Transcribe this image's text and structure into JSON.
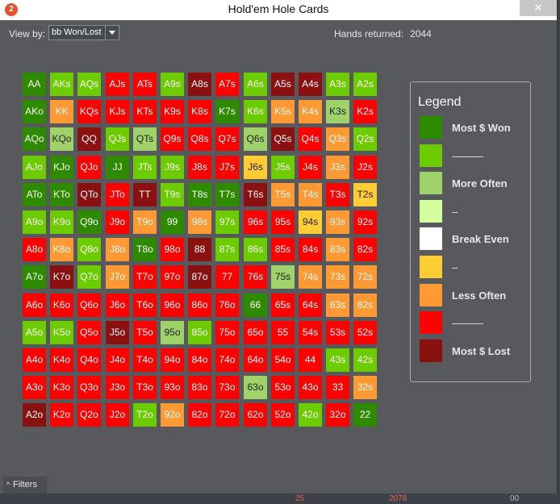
{
  "window": {
    "title": "Hold'em Hole Cards",
    "app_icon": "2",
    "close_glyph": "✕"
  },
  "toolbar": {
    "view_by_label": "View by:",
    "view_by_value": "bb Won/Lost",
    "hands_label": "Hands returned:",
    "hands_value": "2044"
  },
  "grid": {
    "rows": [
      [
        "AA",
        "AKs",
        "AQs",
        "AJs",
        "ATs",
        "A9s",
        "A8s",
        "A7s",
        "A6s",
        "A5s",
        "A4s",
        "A3s",
        "A2s"
      ],
      [
        "AKo",
        "KK",
        "KQs",
        "KJs",
        "KTs",
        "K9s",
        "K8s",
        "K7s",
        "K6s",
        "K5s",
        "K4s",
        "K3s",
        "K2s"
      ],
      [
        "AQo",
        "KQo",
        "QQ",
        "QJs",
        "QTs",
        "Q9s",
        "Q8s",
        "Q7s",
        "Q6s",
        "Q5s",
        "Q4s",
        "Q3s",
        "Q2s"
      ],
      [
        "AJo",
        "KJo",
        "QJo",
        "JJ",
        "JTs",
        "J9s",
        "J8s",
        "J7s",
        "J6s",
        "J5s",
        "J4s",
        "J3s",
        "J2s"
      ],
      [
        "ATo",
        "KTo",
        "QTo",
        "JTo",
        "TT",
        "T9s",
        "T8s",
        "T7s",
        "T6s",
        "T5s",
        "T4s",
        "T3s",
        "T2s"
      ],
      [
        "A9o",
        "K9o",
        "Q9o",
        "J9o",
        "T9o",
        "99",
        "98s",
        "97s",
        "96s",
        "95s",
        "94s",
        "93s",
        "92s"
      ],
      [
        "A8o",
        "K8o",
        "Q8o",
        "J8o",
        "T8o",
        "98o",
        "88",
        "87s",
        "86s",
        "85s",
        "84s",
        "83s",
        "82s"
      ],
      [
        "A7o",
        "K7o",
        "Q7o",
        "J7o",
        "T7o",
        "97o",
        "87o",
        "77",
        "76s",
        "75s",
        "74s",
        "73s",
        "72s"
      ],
      [
        "A6o",
        "K6o",
        "Q6o",
        "J6o",
        "T6o",
        "96o",
        "86o",
        "76o",
        "66",
        "65s",
        "64s",
        "63s",
        "62s"
      ],
      [
        "A5o",
        "K5o",
        "Q5o",
        "J5o",
        "T5o",
        "95o",
        "85o",
        "75o",
        "65o",
        "55",
        "54s",
        "53s",
        "52s"
      ],
      [
        "A4o",
        "K4o",
        "Q4o",
        "J4o",
        "T4o",
        "94o",
        "84o",
        "74o",
        "64o",
        "54o",
        "44",
        "43s",
        "42s"
      ],
      [
        "A3o",
        "K3o",
        "Q3o",
        "J3o",
        "T3o",
        "93o",
        "83o",
        "73o",
        "63o",
        "53o",
        "43o",
        "33",
        "32s"
      ],
      [
        "A2o",
        "K2o",
        "Q2o",
        "J2o",
        "T2o",
        "92o",
        "82o",
        "72o",
        "62o",
        "52o",
        "42o",
        "32o",
        "22"
      ]
    ],
    "levels": [
      [
        0,
        1,
        1,
        7,
        7,
        1,
        8,
        7,
        1,
        8,
        8,
        1,
        1
      ],
      [
        0,
        6,
        7,
        7,
        7,
        7,
        7,
        0,
        1,
        6,
        6,
        2,
        7
      ],
      [
        0,
        2,
        8,
        1,
        2,
        7,
        7,
        7,
        2,
        8,
        7,
        6,
        1
      ],
      [
        1,
        0,
        7,
        0,
        1,
        1,
        7,
        7,
        5,
        1,
        7,
        6,
        7
      ],
      [
        0,
        0,
        8,
        7,
        8,
        1,
        0,
        0,
        8,
        6,
        6,
        7,
        5
      ],
      [
        1,
        1,
        0,
        7,
        6,
        0,
        6,
        1,
        7,
        7,
        5,
        6,
        7
      ],
      [
        7,
        6,
        1,
        6,
        0,
        7,
        8,
        1,
        1,
        7,
        7,
        6,
        7
      ],
      [
        0,
        8,
        1,
        6,
        7,
        7,
        8,
        7,
        7,
        2,
        6,
        6,
        6
      ],
      [
        7,
        7,
        7,
        7,
        7,
        7,
        7,
        7,
        0,
        7,
        7,
        6,
        6
      ],
      [
        1,
        1,
        7,
        8,
        7,
        2,
        1,
        7,
        7,
        7,
        7,
        7,
        7
      ],
      [
        7,
        7,
        7,
        7,
        7,
        7,
        7,
        7,
        7,
        7,
        7,
        1,
        1
      ],
      [
        7,
        7,
        7,
        7,
        7,
        7,
        7,
        7,
        2,
        7,
        7,
        7,
        6
      ],
      [
        8,
        7,
        7,
        7,
        1,
        6,
        7,
        7,
        7,
        7,
        1,
        7,
        0
      ]
    ]
  },
  "legend": {
    "title": "Legend",
    "items": [
      {
        "label": "Most $ Won",
        "color": "#2e8b00"
      },
      {
        "label": "———",
        "color": "#6ccc00"
      },
      {
        "label": "More Often",
        "color": "#a0d26a"
      },
      {
        "label": "–",
        "color": "#d4ff9e"
      },
      {
        "label": "Break Even",
        "color": "#ffffff"
      },
      {
        "label": "–",
        "color": "#ffcc33"
      },
      {
        "label": "Less Often",
        "color": "#ff9933"
      },
      {
        "label": "———",
        "color": "#ff0000"
      },
      {
        "label": "Most $ Lost",
        "color": "#8b1010"
      }
    ]
  },
  "filters": {
    "label": "Filters",
    "chevron": "^"
  },
  "footer": {
    "marks": [
      "25",
      "2078",
      "00"
    ]
  }
}
